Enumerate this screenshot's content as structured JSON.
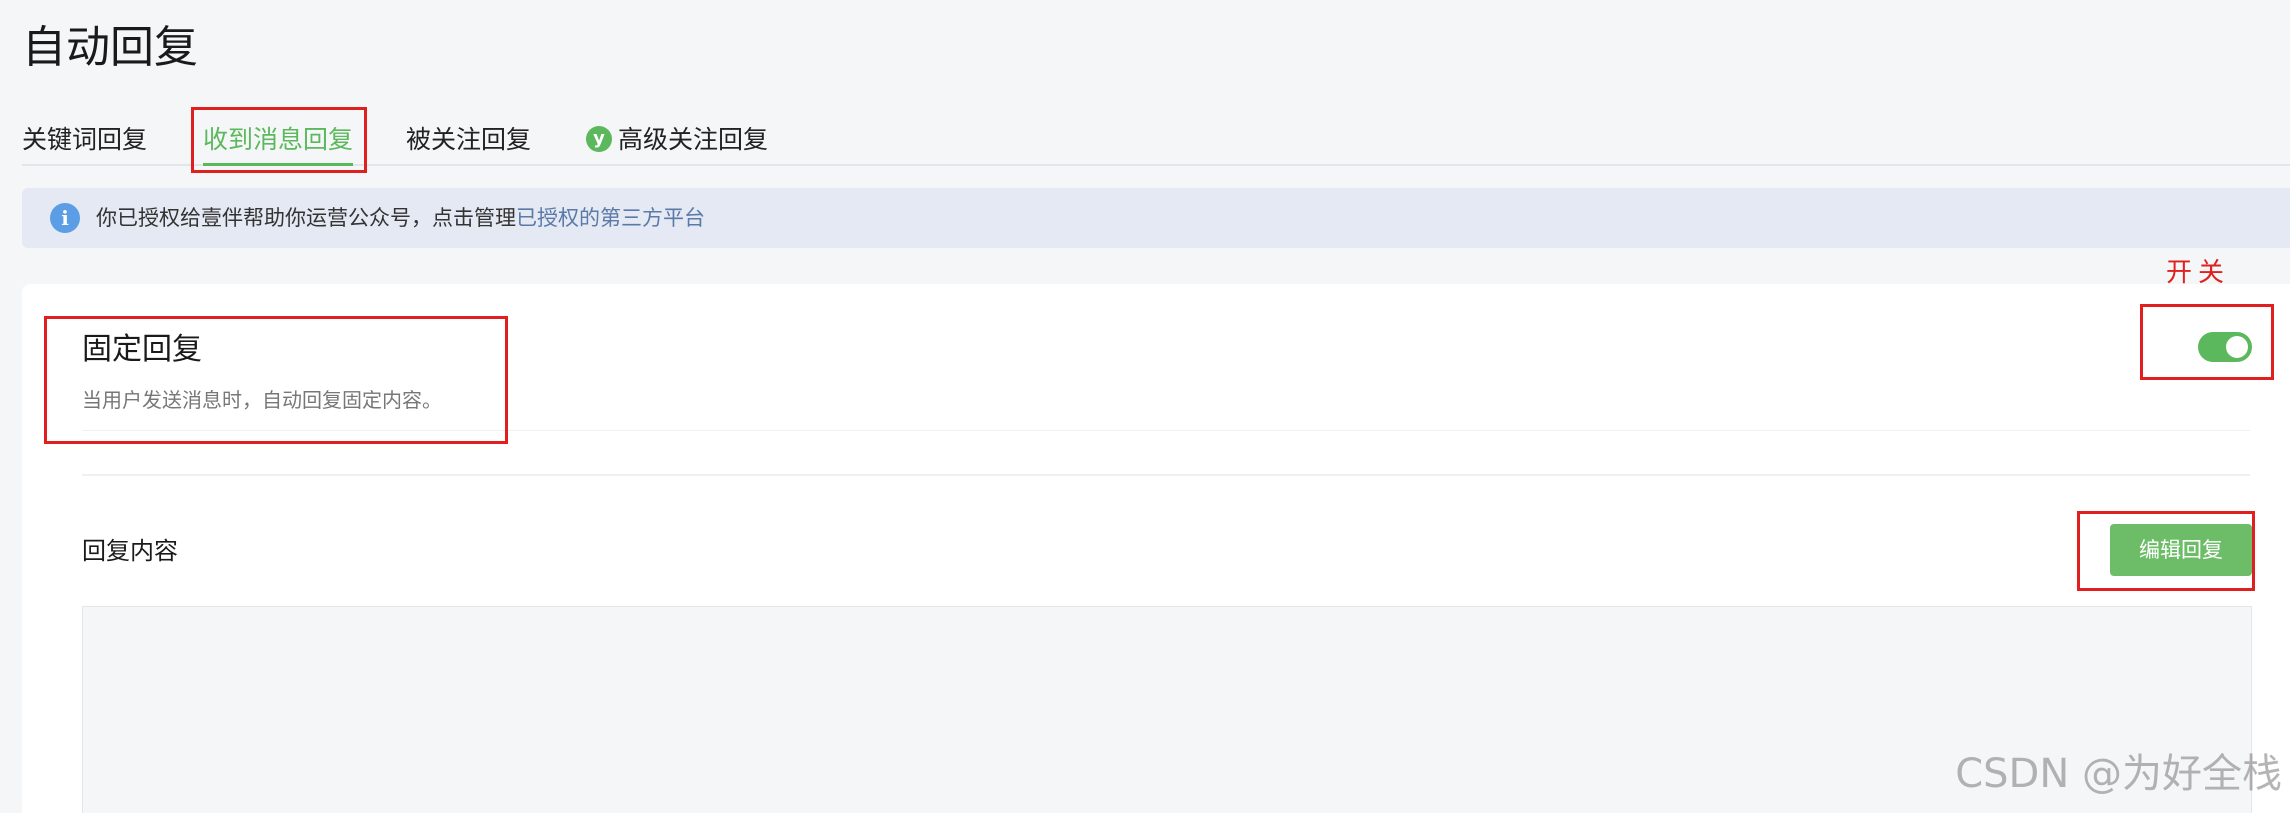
{
  "page": {
    "title": "自动回复"
  },
  "tabs": [
    {
      "label": "关键词回复"
    },
    {
      "label": "收到消息回复",
      "active": true
    },
    {
      "label": "被关注回复"
    },
    {
      "label": "高级关注回复",
      "badge": "y"
    }
  ],
  "info": {
    "text": "你已授权给壹伴帮助你运营公众号，点击管理",
    "link": "已授权的第三方平台",
    "icon": "info-icon"
  },
  "fixed_reply": {
    "title": "固定回复",
    "description": "当用户发送消息时，自动回复固定内容。",
    "toggle_on": true
  },
  "reply_content": {
    "label": "回复内容",
    "edit_button": "编辑回复"
  },
  "annotation": {
    "switch_label": "开关"
  },
  "watermark": "CSDN @为好全栈",
  "colors": {
    "accent": "#5cb85c",
    "button": "#6dbd68",
    "annotation": "#e0201f",
    "info_bg": "#e4e9f3"
  }
}
